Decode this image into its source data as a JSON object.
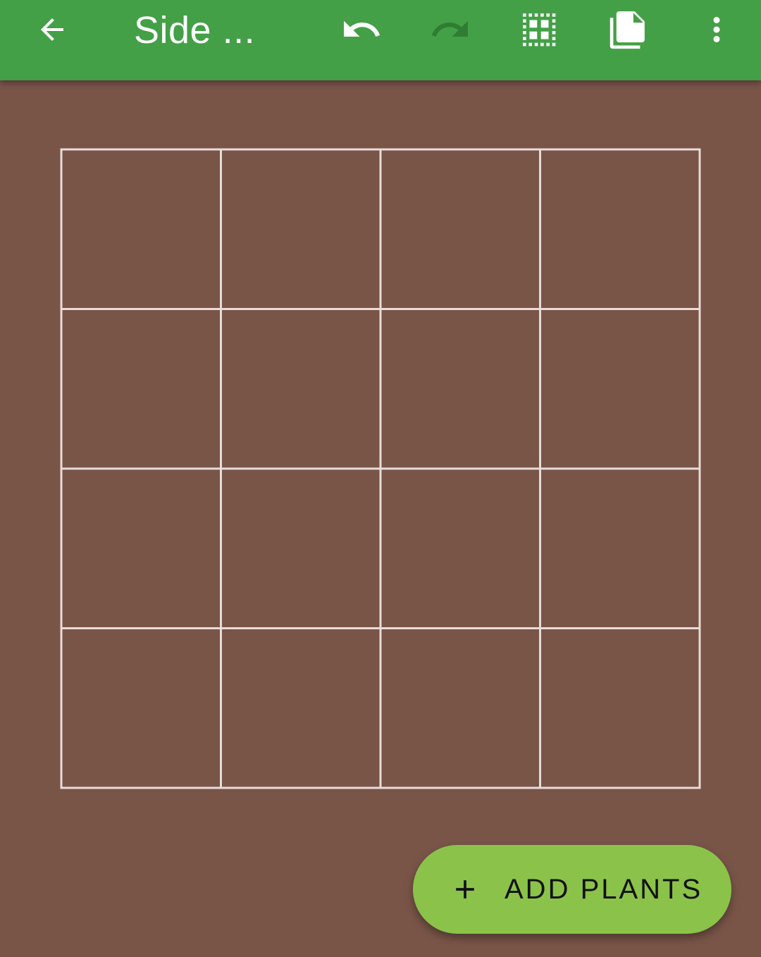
{
  "app_bar": {
    "title": "Side ...",
    "background_color": "#43A047",
    "icons": {
      "back": "arrow-back-icon",
      "undo": "undo-icon",
      "redo": "redo-icon",
      "grid": "grid-toggle-icon",
      "copy": "copy-icon",
      "more": "more-vert-icon"
    },
    "redo_enabled": false
  },
  "garden_bed": {
    "rows": 4,
    "columns": 4,
    "soil_color": "#795548",
    "grid_line_color": "#E8DCD8"
  },
  "fab": {
    "label": "ADD PLANTS",
    "icon": "plus-icon",
    "color": "#8BC34A"
  }
}
